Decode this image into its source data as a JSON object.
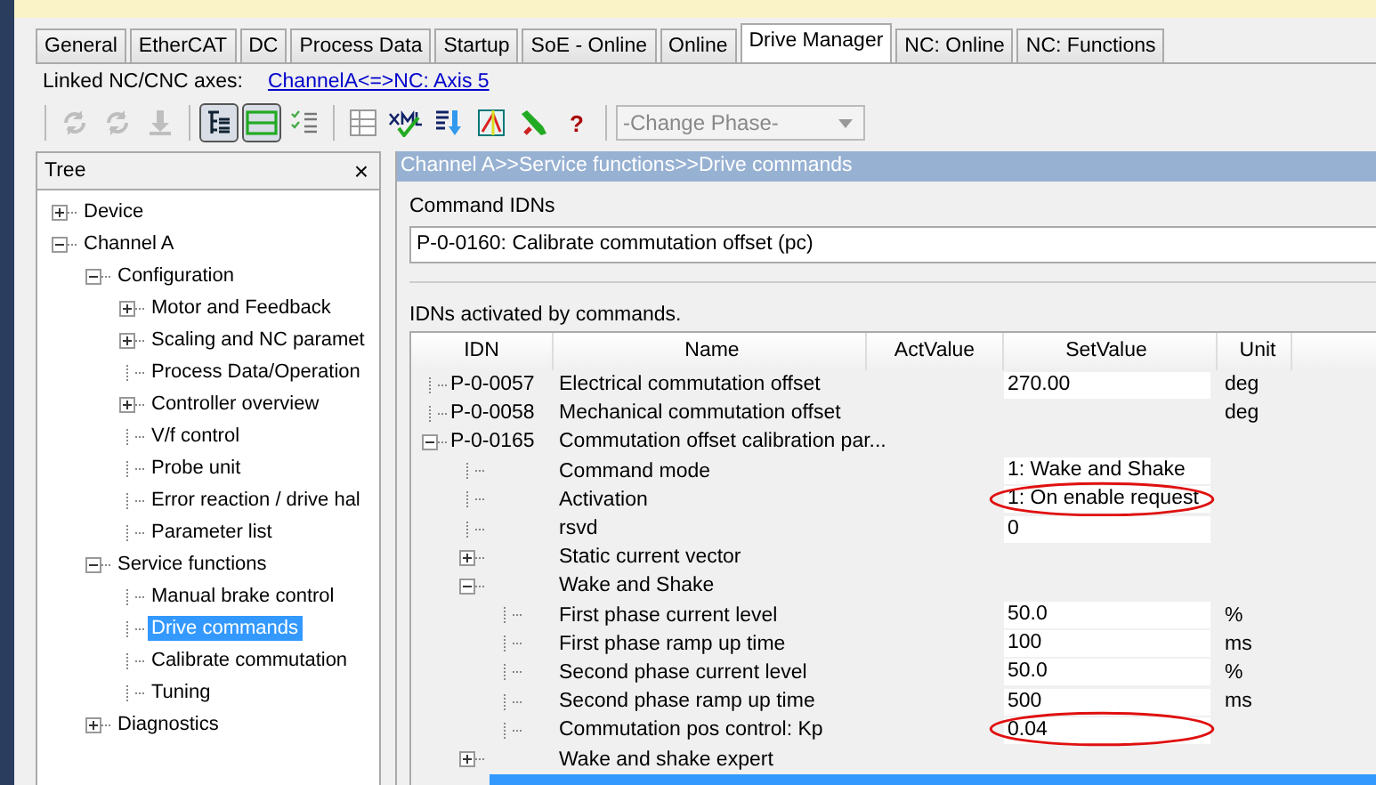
{
  "tabs": [
    {
      "label": "General",
      "selected": false
    },
    {
      "label": "EtherCAT",
      "selected": false
    },
    {
      "label": "DC",
      "selected": false
    },
    {
      "label": "Process Data",
      "selected": false
    },
    {
      "label": "Startup",
      "selected": false
    },
    {
      "label": "SoE - Online",
      "selected": false
    },
    {
      "label": "Online",
      "selected": false
    },
    {
      "label": "Drive Manager",
      "selected": true
    },
    {
      "label": "NC: Online",
      "selected": false
    },
    {
      "label": "NC: Functions",
      "selected": false
    }
  ],
  "linked_axes": {
    "label": "Linked NC/CNC axes:",
    "link": "ChannelA<=>NC: Axis 5"
  },
  "toolbar": {
    "buttons": [
      {
        "kind": "refresh",
        "disabled": true
      },
      {
        "kind": "reload",
        "disabled": true
      },
      {
        "kind": "download",
        "disabled": true
      },
      {
        "kind": "tree",
        "disabled": false,
        "pressed": true
      },
      {
        "kind": "panel",
        "disabled": false,
        "pressed": true
      },
      {
        "kind": "checklist",
        "disabled": false
      },
      {
        "kind": "table",
        "disabled": false
      },
      {
        "kind": "xml",
        "disabled": false
      },
      {
        "kind": "import",
        "disabled": false
      },
      {
        "kind": "chart",
        "disabled": false
      },
      {
        "kind": "wrench",
        "disabled": false
      },
      {
        "kind": "help",
        "label": "?",
        "disabled": false
      }
    ],
    "phase": {
      "value": "-Change Phase-",
      "disabled": true
    }
  },
  "tree": {
    "title": "Tree",
    "close": "×",
    "items": [
      {
        "label": "Device",
        "expanded": false,
        "selected": false
      },
      {
        "label": "Channel A",
        "expanded": true,
        "selected": false,
        "children": [
          {
            "label": "Configuration",
            "expanded": true,
            "selected": false,
            "children": [
              {
                "label": "Motor and Feedback",
                "expanded": false,
                "selected": false
              },
              {
                "label": "Scaling and NC paramet",
                "expanded": false,
                "selected": false
              },
              {
                "label": "Process Data/Operation",
                "selected": false
              },
              {
                "label": "Controller overview",
                "expanded": false,
                "selected": false
              },
              {
                "label": "V/f control",
                "selected": false
              },
              {
                "label": "Probe unit",
                "selected": false
              },
              {
                "label": "Error reaction / drive hal",
                "selected": false
              },
              {
                "label": "Parameter list",
                "selected": false
              }
            ]
          },
          {
            "label": "Service functions",
            "expanded": true,
            "selected": false,
            "children": [
              {
                "label": "Manual brake control",
                "selected": false
              },
              {
                "label": "Drive commands",
                "selected": true
              },
              {
                "label": "Calibrate commutation",
                "selected": false
              },
              {
                "label": "Tuning",
                "selected": false
              }
            ]
          },
          {
            "label": "Diagnostics",
            "expanded": false,
            "selected": false
          }
        ]
      }
    ]
  },
  "panel": {
    "breadcrumb": "Channel A>>Service functions>>Drive commands",
    "command_label": "Command IDNs",
    "command_value": "P-0-0160: Calibrate commutation offset (pc)",
    "activated_label": "IDNs activated by commands.",
    "table": {
      "columns": [
        "IDN",
        "Name",
        "ActValue",
        "SetValue",
        "Unit"
      ],
      "rows": [
        {
          "idn": "P-0-0057",
          "name": "Electrical commutation offset",
          "set_value": "270.00",
          "unit": "deg"
        },
        {
          "idn": "P-0-0058",
          "name": "Mechanical commutation offset",
          "unit": "deg"
        },
        {
          "idn": "P-0-0165",
          "name": "Commutation offset calibration par...",
          "expanded": true,
          "children": [
            {
              "name": "Command mode",
              "set_value": "1: Wake and Shake"
            },
            {
              "name": "Activation",
              "set_value": "1: On enable request",
              "highlighted": true
            },
            {
              "name": "rsvd",
              "set_value": "0"
            },
            {
              "name": "Static current vector",
              "expanded": false
            },
            {
              "name": "Wake and Shake",
              "expanded": true,
              "children": [
                {
                  "name": "First phase current level",
                  "set_value": "50.0",
                  "unit": "%"
                },
                {
                  "name": "First phase ramp up time",
                  "set_value": "100",
                  "unit": "ms"
                },
                {
                  "name": "Second phase current level",
                  "set_value": "50.0",
                  "unit": "%"
                },
                {
                  "name": "Second phase ramp up time",
                  "set_value": "500",
                  "unit": "ms"
                },
                {
                  "name": "Commutation pos control: Kp",
                  "set_value": "0.04",
                  "highlighted": true
                }
              ]
            },
            {
              "name": "Wake and shake expert",
              "expanded": false
            }
          ]
        }
      ]
    }
  }
}
